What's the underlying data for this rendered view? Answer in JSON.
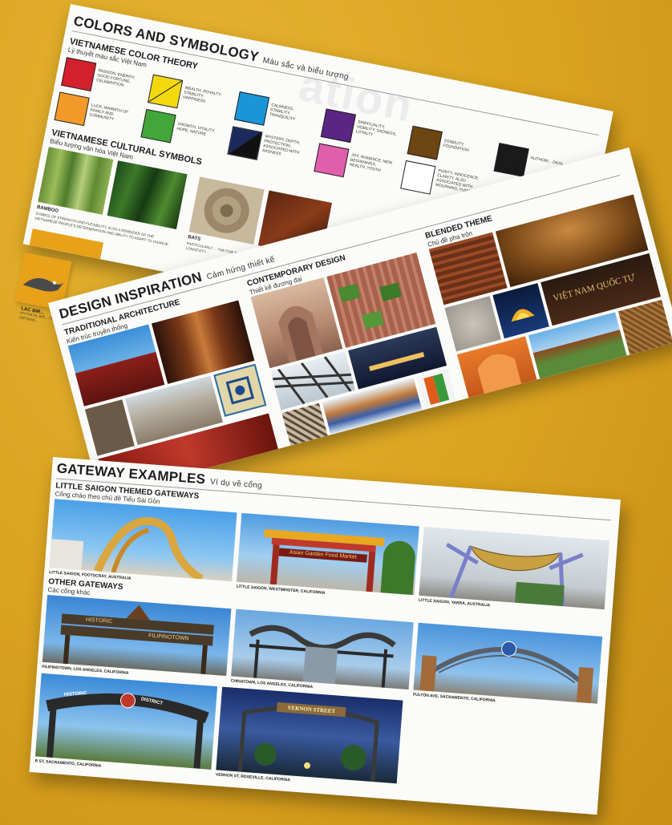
{
  "colors": {
    "background": "#d9a21f",
    "red": "#d4202c",
    "yellow": "#f3d80e",
    "blue": "#1a96d8",
    "purple": "#5a2583",
    "brown": "#6b4512",
    "black": "#1a1a1a",
    "orange": "#f19a2a",
    "green": "#43a638",
    "navy": "#1b2a5c",
    "pink": "#e05fad",
    "white": "#ffffff"
  },
  "sheet1": {
    "title": "COLORS AND SYMBOLOGY",
    "title_vn": "Màu sắc và biểu tượng",
    "color_theory": {
      "heading": "VIETNAMESE COLOR THEORY",
      "heading_vn": "Lý thuyết màu sắc Việt Nam",
      "swatches": [
        {
          "color": "red",
          "text": "PASSION, ENERGY, GOOD FORTUNE, CELEBRATION"
        },
        {
          "color": "yellow",
          "text": "WEALTH, ROYALTY, STABILITY, HAPPINESS"
        },
        {
          "color": "blue",
          "text": "CALMNESS, STABILITY, TRANQUILITY"
        },
        {
          "color": "purple",
          "text": "SPIRITUALITY, NOBILITY, SADNESS, LOYALTY"
        },
        {
          "color": "brown",
          "text": "STABILITY, FOUNDATION"
        },
        {
          "color": "black",
          "text": "AUTHORI... DIGN..."
        },
        {
          "color": "orange",
          "text": "LUCK, WARMTH OF FAMILY AND COMMUNITY"
        },
        {
          "color": "green",
          "text": "GROWTH, VITALITY, HOPE, NATURE"
        },
        {
          "color": "navy",
          "text": "MYSTERY, DEPTH, PROTECTION, ASSOCIATED WITH SADNESS"
        },
        {
          "color": "pink",
          "text": "JOY, ROMANCE, NEW BEGINNINGS, HEALTH, YOUTH"
        },
        {
          "color": "white",
          "text": "PURITY, INNOCENCE, CLARITY. ALSO ASSOCIATED WITH MOURNING, FUNER..."
        }
      ]
    },
    "symbols": {
      "heading": "VIETNAMESE CULTURAL SYMBOLS",
      "heading_vn": "Biểu tượng văn hóa Việt Nam",
      "bamboo_label": "BAMBOO",
      "bamboo_desc": "SYMBOL OF STRENGTH AND FLEXIBILITY. ALSO A REMINDER OF THE VIETNAMESE PEOPLE'S DETERMINATION AND ABILITY TO ADAPT TO CHANGE.",
      "bats_label": "BATS",
      "bats_desc": "PARTICULARLY ... THE FIVE B... LONGEVITY...",
      "lac_label": "LAC BIR...",
      "lac_desc": "MYTHICAL BIR... THE VIETNAM..."
    }
  },
  "sheet2": {
    "title": "DESIGN INSPIRATION",
    "title_vn": "Cảm hứng thiết kế",
    "traditional": "TRADITIONAL ARCHITECTURE",
    "traditional_vn": "Kiến trúc truyền thống",
    "contemporary": "CONTEMPORARY DESIGN",
    "contemporary_vn": "Thiết kế đương đại",
    "blended": "BLENDED THEME",
    "blended_vn": "Chủ đề pha trộn",
    "sign_text": "VIỆT NAM QUỐC TỰ"
  },
  "sheet3": {
    "title": "GATEWAY EXAMPLES",
    "title_vn": "Ví dụ về cổng",
    "little_saigon": "LITTLE SAIGON THEMED GATEWAYS",
    "little_saigon_vn": "Cổng chào theo chủ đề Tiểu Sài Gòn",
    "other": "OTHER GATEWAYS",
    "other_vn": "Các cổng khác",
    "captions": {
      "footscray": "LITTLE SAIGON, FOOTSCRAY, AUSTRALIA",
      "westminster": "LITTLE SAIGON, WESTMINSTER, CALIFORNIA",
      "yarra": "LITTLE SAIGON, YARRA, AUSTRALIA",
      "filipinotown": "FILIPINOTOWN, LOS ANGELES, CALIFORNIA",
      "chinatown": "CHINATOWN, LOS ANGELES, CALIFORNIA",
      "fulton": "FULTON AVE, SACRAMENTO, CALIFORNIA",
      "rst": "R ST, SACRAMENTO, CALIFORNIA",
      "vernon": "VERNON ST, ROSEVILLE, CALIFORNIA"
    },
    "sign_food_market": "Asian Garden Food Market",
    "sign_historic": "HISTORIC",
    "sign_filipinotown": "FILIPINOTOWN",
    "sign_historic_r": "HISTORIC",
    "sign_district": "DISTRICT",
    "sign_vernon": "VERNON STREET"
  }
}
